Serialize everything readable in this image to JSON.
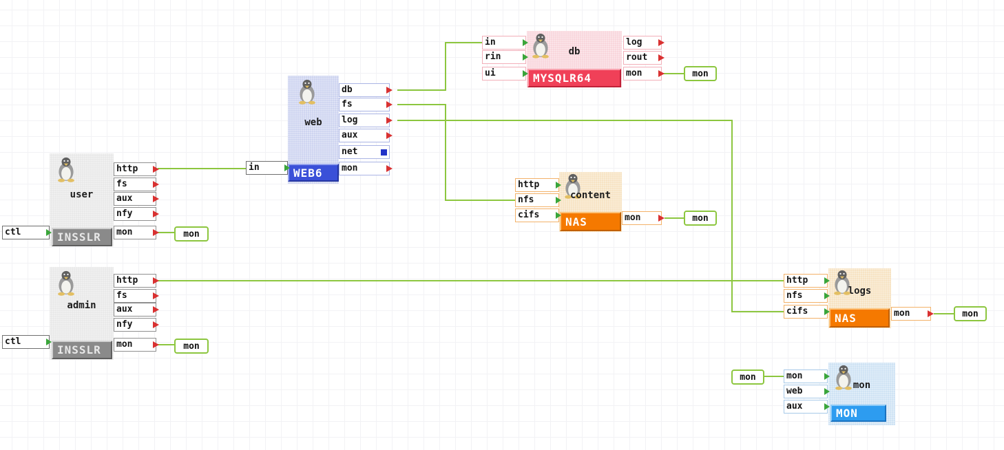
{
  "app": {
    "background_color": "#ffffff",
    "grid_color": "#f2f2f5",
    "wire_color": "#8cc63e",
    "input_arrow_color": "#3aa53a",
    "output_arrow_color": "#d93131",
    "net_square_color": "#2233c8"
  },
  "nodes": {
    "user": {
      "title": "user",
      "badge": "INSSLR",
      "inputs": [
        {
          "label": "ctl"
        }
      ],
      "outputs": [
        {
          "label": "http"
        },
        {
          "label": "fs"
        },
        {
          "label": "aux"
        },
        {
          "label": "nfy"
        },
        {
          "label": "mon"
        }
      ],
      "colors": {
        "body": "#e9e9e9",
        "border": "#8f8f8f",
        "badge_bg": "#8a8a8a",
        "badge_text": "#e8e8e8"
      }
    },
    "admin": {
      "title": "admin",
      "badge": "INSSLR",
      "inputs": [
        {
          "label": "ctl"
        }
      ],
      "outputs": [
        {
          "label": "http"
        },
        {
          "label": "fs"
        },
        {
          "label": "aux"
        },
        {
          "label": "nfy"
        },
        {
          "label": "mon"
        }
      ],
      "colors": {
        "body": "#e9e9e9",
        "border": "#8f8f8f",
        "badge_bg": "#8a8a8a",
        "badge_text": "#e8e8e8"
      }
    },
    "web": {
      "title": "web",
      "badge": "WEB6",
      "inputs": [
        {
          "label": "in"
        }
      ],
      "outputs": [
        {
          "label": "db"
        },
        {
          "label": "fs"
        },
        {
          "label": "log"
        },
        {
          "label": "aux"
        },
        {
          "label": "net",
          "marker": "square"
        },
        {
          "label": "mon"
        }
      ],
      "colors": {
        "body": "#ced4f0",
        "border": "#aab4e4",
        "badge_bg": "#3a50d8",
        "badge_text": "#ffffff"
      }
    },
    "db": {
      "title": "db",
      "badge": "MYSQLR64",
      "inputs": [
        {
          "label": "in"
        },
        {
          "label": "rin"
        },
        {
          "label": "ui"
        }
      ],
      "outputs": [
        {
          "label": "log"
        },
        {
          "label": "rout"
        },
        {
          "label": "mon"
        }
      ],
      "colors": {
        "body": "#f9d6dc",
        "border": "#f2aeb8",
        "badge_bg": "#f04058",
        "badge_text": "#ffffff"
      }
    },
    "content": {
      "title": "content",
      "badge": "NAS",
      "inputs": [
        {
          "label": "http"
        },
        {
          "label": "nfs"
        },
        {
          "label": "cifs"
        }
      ],
      "outputs": [
        {
          "label": "mon"
        }
      ],
      "colors": {
        "body": "#f7e3c3",
        "border": "#f3b168",
        "badge_bg": "#f57900",
        "badge_text": "#ffffff"
      }
    },
    "logs": {
      "title": "logs",
      "badge": "NAS",
      "inputs": [
        {
          "label": "http"
        },
        {
          "label": "nfs"
        },
        {
          "label": "cifs"
        }
      ],
      "outputs": [
        {
          "label": "mon"
        }
      ],
      "colors": {
        "body": "#f7e3c3",
        "border": "#f3b168",
        "badge_bg": "#f57900",
        "badge_text": "#ffffff"
      }
    },
    "mon": {
      "title": "mon",
      "badge": "MON",
      "inputs": [
        {
          "label": "mon"
        },
        {
          "label": "web"
        },
        {
          "label": "aux"
        }
      ],
      "outputs": [],
      "colors": {
        "body": "#cfe3f4",
        "border": "#a6c9e8",
        "badge_bg": "#2d9cf0",
        "badge_text": "#ffffff"
      }
    }
  },
  "terminals": {
    "user_mon": {
      "label": "mon"
    },
    "admin_mon": {
      "label": "mon"
    },
    "db_mon": {
      "label": "mon"
    },
    "content_mon": {
      "label": "mon"
    },
    "logs_mon": {
      "label": "mon"
    },
    "mon_in": {
      "label": "mon"
    }
  },
  "connections": [
    {
      "from": "user.http",
      "to": "web.in"
    },
    {
      "from": "user.mon",
      "to": "terminal:user_mon"
    },
    {
      "from": "admin.http",
      "to": "logs.http"
    },
    {
      "from": "admin.mon",
      "to": "terminal:admin_mon"
    },
    {
      "from": "web.db",
      "to": "db.in"
    },
    {
      "from": "web.fs",
      "to": "content.nfs"
    },
    {
      "from": "web.log",
      "to": "logs.cifs"
    },
    {
      "from": "db.mon",
      "to": "terminal:db_mon"
    },
    {
      "from": "content.mon",
      "to": "terminal:content_mon"
    },
    {
      "from": "logs.mon",
      "to": "terminal:logs_mon"
    },
    {
      "from": "terminal:mon_in",
      "to": "mon.mon"
    }
  ]
}
